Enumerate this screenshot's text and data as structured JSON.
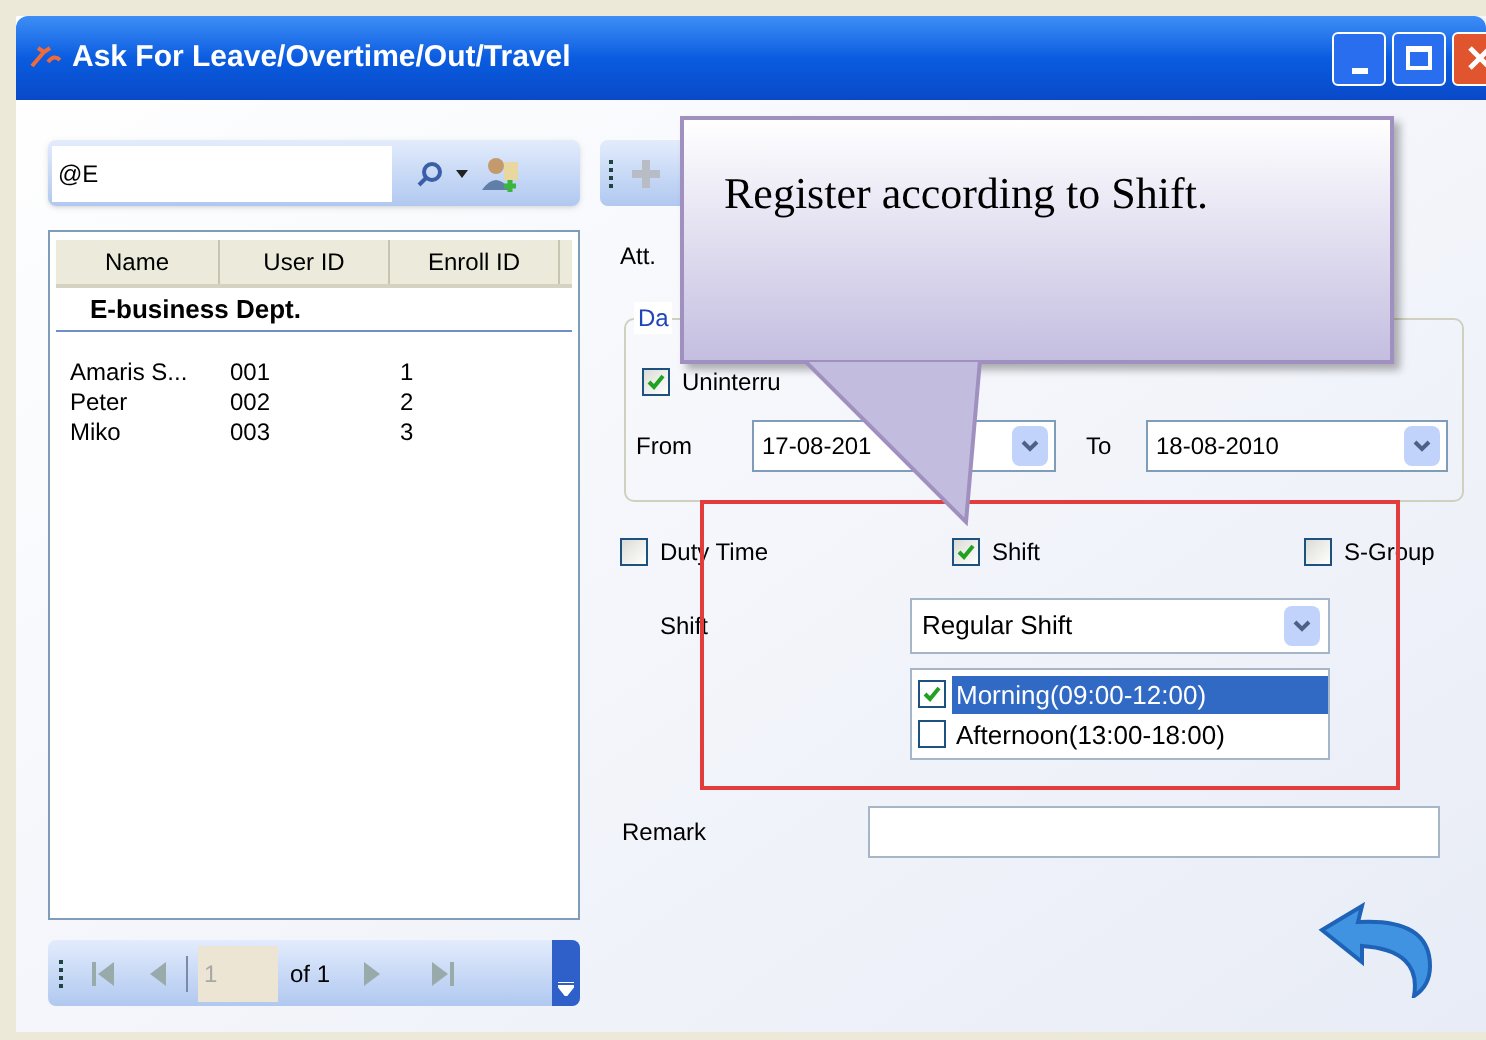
{
  "window": {
    "title": "Ask For Leave/Overtime/Out/Travel"
  },
  "search": {
    "value": "@E"
  },
  "employee_list": {
    "columns": [
      "Name",
      "User ID",
      "Enroll ID"
    ],
    "group": "E-business Dept.",
    "rows": [
      {
        "cells": [
          "Amaris S...",
          "001",
          "1"
        ]
      },
      {
        "cells": [
          "Peter",
          "002",
          "2"
        ]
      },
      {
        "cells": [
          "Miko",
          "003",
          "3"
        ]
      }
    ]
  },
  "pager": {
    "page": "1",
    "total": "of 1"
  },
  "form": {
    "att_label": "Att.",
    "date_group": "Da",
    "uninterrupted": {
      "label": "Uninterru",
      "checked": true
    },
    "from_label": "From",
    "from_value": "17-08-201",
    "to_label": "To",
    "to_value": "18-08-2010",
    "modes": [
      {
        "label": "Duty Time",
        "checked": false
      },
      {
        "label": "Shift",
        "checked": true
      },
      {
        "label": "S-Group",
        "checked": false
      }
    ],
    "shift_label": "Shift",
    "shift_value": "Regular Shift",
    "shift_periods": [
      {
        "label": "Morning(09:00-12:00)",
        "checked": true,
        "selected": true
      },
      {
        "label": "Afternoon(13:00-18:00)",
        "checked": false,
        "selected": false
      }
    ],
    "remark_label": "Remark"
  },
  "callout": {
    "text": "Register according to Shift."
  }
}
